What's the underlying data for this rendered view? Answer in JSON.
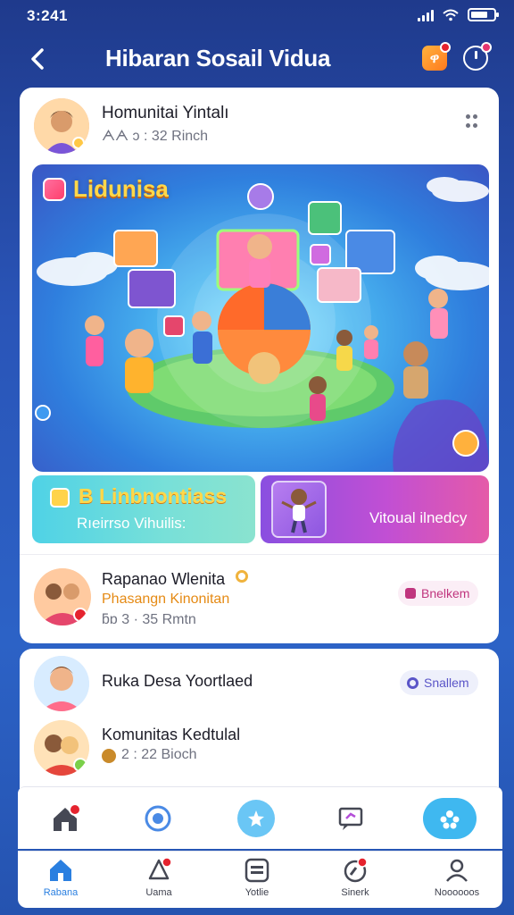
{
  "status_bar": {
    "time": "3:241"
  },
  "header": {
    "title": "Hibaran Sosail Vidua",
    "app_icon_glyph": "ዋ"
  },
  "post": {
    "author": "Homunitai Yintalı",
    "meta": "ᗅᗅ ɔ : 32 Rinch",
    "hero_tag": "Lidunisa",
    "tile_left": {
      "title": "B Linbnontiass",
      "subtitle": "Rıeirrso Vihuilis:"
    },
    "tile_right": {
      "text": "Vitoual ilnedcy"
    }
  },
  "rows": [
    {
      "name": "Rapanao Wlenita",
      "subtitle": "Phasangn Kinonitan",
      "meta": "ƃɒ 3 · 35 Rmtn",
      "chip": "Bnelkem"
    },
    {
      "name": "Ruka Desa Yoortlaed",
      "chip": "Snallem"
    },
    {
      "name": "Komunitas Kedtulal",
      "meta": "2 : 22 Bioch"
    }
  ],
  "bottom_nav": {
    "items": [
      {
        "label": "Rabana",
        "active": true
      },
      {
        "label": "Uama"
      },
      {
        "label": "Yotlie"
      },
      {
        "label": "Sinerk"
      },
      {
        "label": "Noooooos"
      }
    ]
  },
  "colors": {
    "accent": "#2a7fe0",
    "badge": "#e5232e",
    "header_bg": "#1f3a8c"
  },
  "icons": [
    "back-icon",
    "app-icon",
    "timer-icon",
    "more-icon",
    "home-icon",
    "bell-icon",
    "video-icon",
    "camera-icon",
    "profile-icon"
  ]
}
